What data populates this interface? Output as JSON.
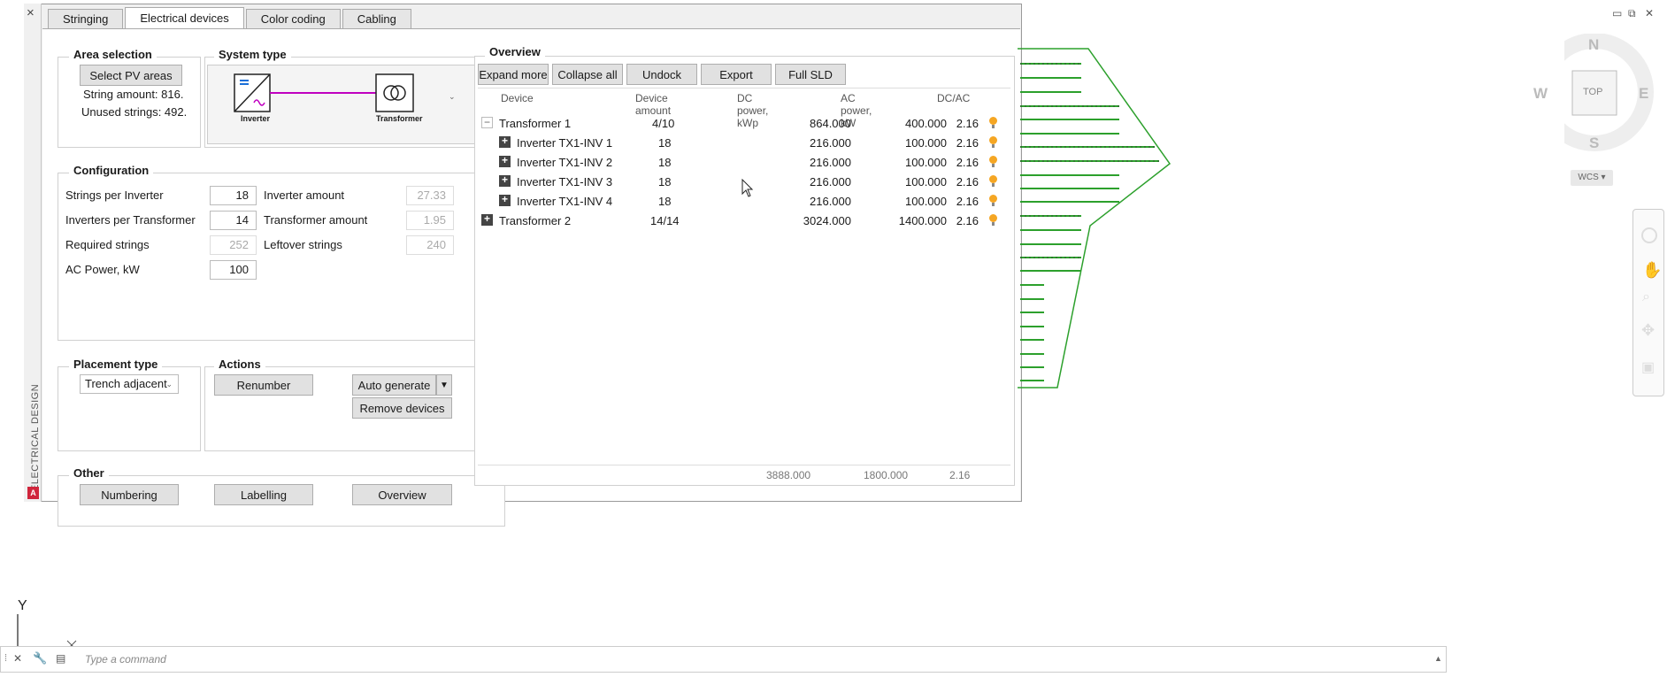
{
  "palette": {
    "side_title": "ELECTRICAL DESIGN",
    "tabs": [
      "Stringing",
      "Electrical devices",
      "Color coding",
      "Cabling"
    ],
    "active_tab": "Electrical devices",
    "area_selection": {
      "title": "Area selection",
      "button": "Select PV areas",
      "string_amount": "String amount: 816.",
      "unused_strings": "Unused strings: 492."
    },
    "system_type": {
      "title": "System type",
      "inverter_label": "Inverter",
      "transformer_label": "Transformer"
    },
    "configuration": {
      "title": "Configuration",
      "strings_per_inverter_label": "Strings per Inverter",
      "strings_per_inverter": "18",
      "inverters_per_transformer_label": "Inverters per Transformer",
      "inverters_per_transformer": "14",
      "required_strings_label": "Required strings",
      "required_strings": "252",
      "ac_power_label": "AC Power, kW",
      "ac_power": "100",
      "inverter_amount_label": "Inverter amount",
      "inverter_amount": "27.33",
      "transformer_amount_label": "Transformer amount",
      "transformer_amount": "1.95",
      "leftover_strings_label": "Leftover strings",
      "leftover_strings": "240"
    },
    "placement": {
      "title": "Placement type",
      "value": "Trench adjacent"
    },
    "actions": {
      "title": "Actions",
      "renumber": "Renumber",
      "auto_generate": "Auto generate",
      "remove_devices": "Remove devices"
    },
    "other": {
      "title": "Other",
      "numbering": "Numbering",
      "labelling": "Labelling",
      "overview": "Overview"
    },
    "overview": {
      "title": "Overview",
      "buttons": [
        "Expand more",
        "Collapse all",
        "Undock",
        "Export",
        "Full SLD"
      ],
      "columns": [
        "Device",
        "Device amount",
        "DC power, kWp",
        "AC power, kW",
        "DC/AC"
      ],
      "rows": [
        {
          "device": "Transformer 1",
          "amount": "4/10",
          "dc": "864.000",
          "ac": "400.000",
          "ratio": "2.16"
        },
        {
          "device": "Inverter TX1-INV 1",
          "amount": "18",
          "dc": "216.000",
          "ac": "100.000",
          "ratio": "2.16"
        },
        {
          "device": "Inverter TX1-INV 2",
          "amount": "18",
          "dc": "216.000",
          "ac": "100.000",
          "ratio": "2.16"
        },
        {
          "device": "Inverter TX1-INV 3",
          "amount": "18",
          "dc": "216.000",
          "ac": "100.000",
          "ratio": "2.16"
        },
        {
          "device": "Inverter TX1-INV 4",
          "amount": "18",
          "dc": "216.000",
          "ac": "100.000",
          "ratio": "2.16"
        },
        {
          "device": "Transformer 2",
          "amount": "14/14",
          "dc": "3024.000",
          "ac": "1400.000",
          "ratio": "2.16"
        }
      ],
      "totals": {
        "dc": "3888.000",
        "ac": "1800.000",
        "ratio": "2.16"
      }
    }
  },
  "viewcube": {
    "n": "N",
    "s": "S",
    "e": "E",
    "w": "W",
    "face": "TOP",
    "wcs": "WCS"
  },
  "ucs": {
    "y_label": "Y"
  },
  "command": {
    "placeholder": "Type a command"
  },
  "colors": {
    "accent_green": "#2ca02c",
    "bulb": "#f5a623",
    "sld_line": "#c000c0"
  }
}
